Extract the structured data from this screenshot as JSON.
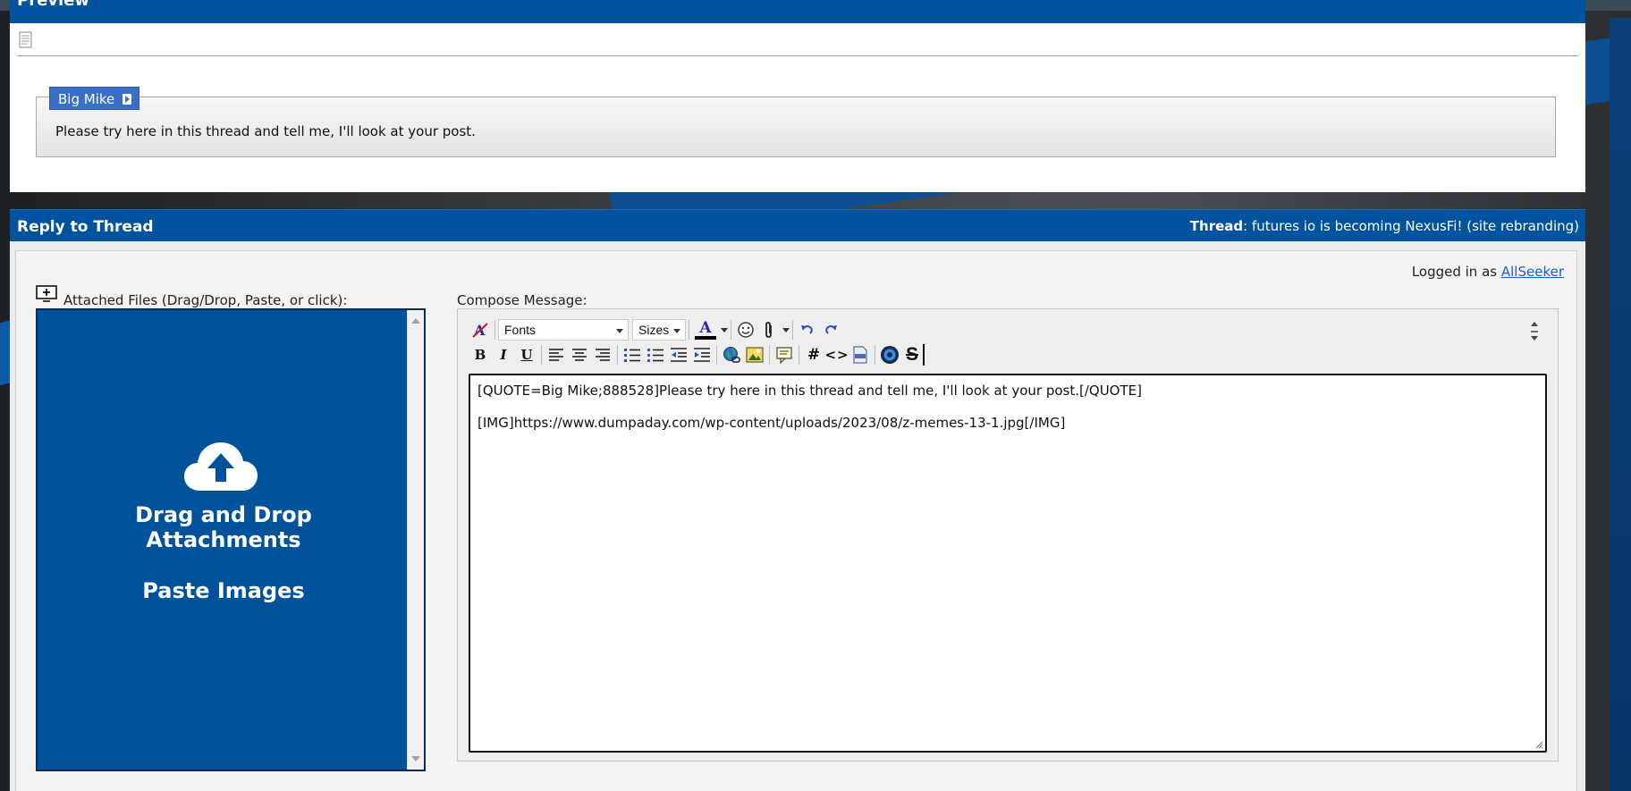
{
  "preview": {
    "title": "Preview",
    "quote": {
      "author": "Big Mike",
      "text": "Please try here in this thread and tell me, I'll look at your post."
    }
  },
  "reply": {
    "title": "Reply to Thread",
    "thread_prefix": "Thread",
    "thread_title": ": futures io is becoming NexusFi! (site rebranding)",
    "logged_in_prefix": "Logged in as ",
    "username": "AllSeeker",
    "attach_label": "Attached Files (Drag/Drop, Paste, or click):",
    "dropzone": {
      "line1a": "Drag and Drop",
      "line1b": "Attachments",
      "line2": "Paste Images"
    },
    "compose_label": "Compose Message:",
    "editor": {
      "fonts_label": "Fonts",
      "sizes_label": "Sizes",
      "bold": "B",
      "italic": "I",
      "underline": "U",
      "font_color_glyph": "A",
      "hash_glyph": "#",
      "code_glyph": "<>",
      "strike_glyph": "S",
      "lines": [
        "[QUOTE=Big Mike;888528]Please try here in this thread and tell me, I'll look at your post.[/QUOTE]",
        "[IMG]https://www.dumpaday.com/wp-content/uploads/2023/08/z-memes-13-1.jpg[/IMG]"
      ]
    }
  },
  "colors": {
    "header_blue": "#00539f",
    "dropzone_blue": "#00529b",
    "quote_author_blue": "#3a6fc8",
    "link_blue": "#1a5fc8"
  }
}
